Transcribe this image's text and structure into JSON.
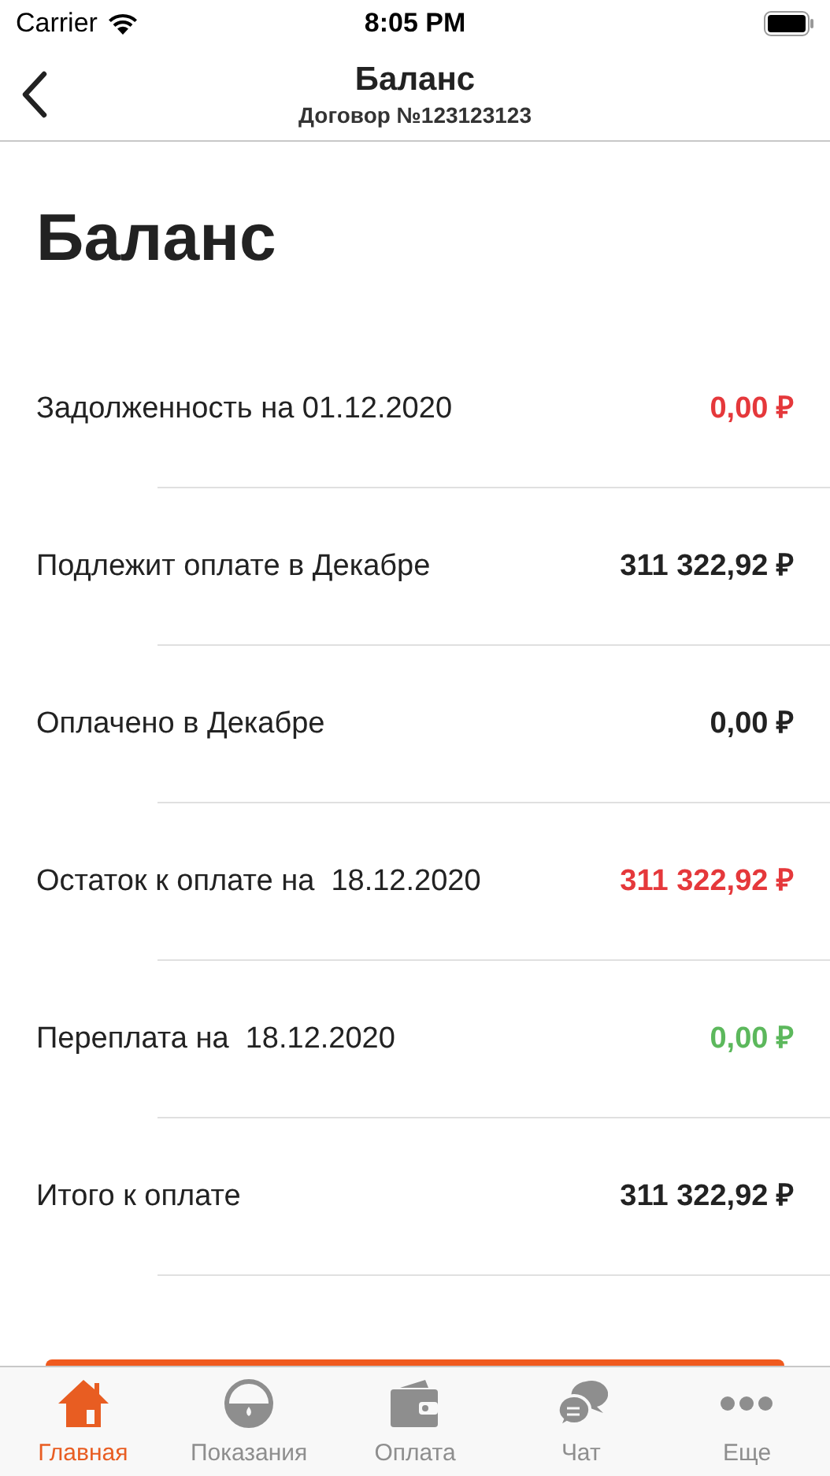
{
  "status_bar": {
    "carrier": "Carrier",
    "time": "8:05 PM"
  },
  "nav": {
    "title": "Баланс",
    "subtitle": "Договор №123123123"
  },
  "heading": "Баланс",
  "rows": [
    {
      "label": "Задолженность на 01.12.2020",
      "amount": "0,00 ₽",
      "color": "#e5383b"
    },
    {
      "label": "Подлежит оплате в Декабре",
      "amount": "311 322,92 ₽",
      "color": "#222222"
    },
    {
      "label": "Оплачено в Декабре",
      "amount": "0,00 ₽",
      "color": "#222222"
    },
    {
      "label": "Остаток к оплате на  18.12.2020",
      "amount": "311 322,92 ₽",
      "color": "#e5383b"
    },
    {
      "label": "Переплата на  18.12.2020",
      "amount": "0,00 ₽",
      "color": "#5cb85c"
    },
    {
      "label": "Итого к оплате",
      "amount": "311 322,92 ₽",
      "color": "#222222"
    }
  ],
  "tabs": [
    {
      "kind": "home",
      "label": "Главная",
      "selected": true
    },
    {
      "kind": "meter",
      "label": "Показания",
      "selected": false
    },
    {
      "kind": "wallet",
      "label": "Оплата",
      "selected": false
    },
    {
      "kind": "chat",
      "label": "Чат",
      "selected": false
    },
    {
      "kind": "more",
      "label": "Еще",
      "selected": false
    }
  ]
}
